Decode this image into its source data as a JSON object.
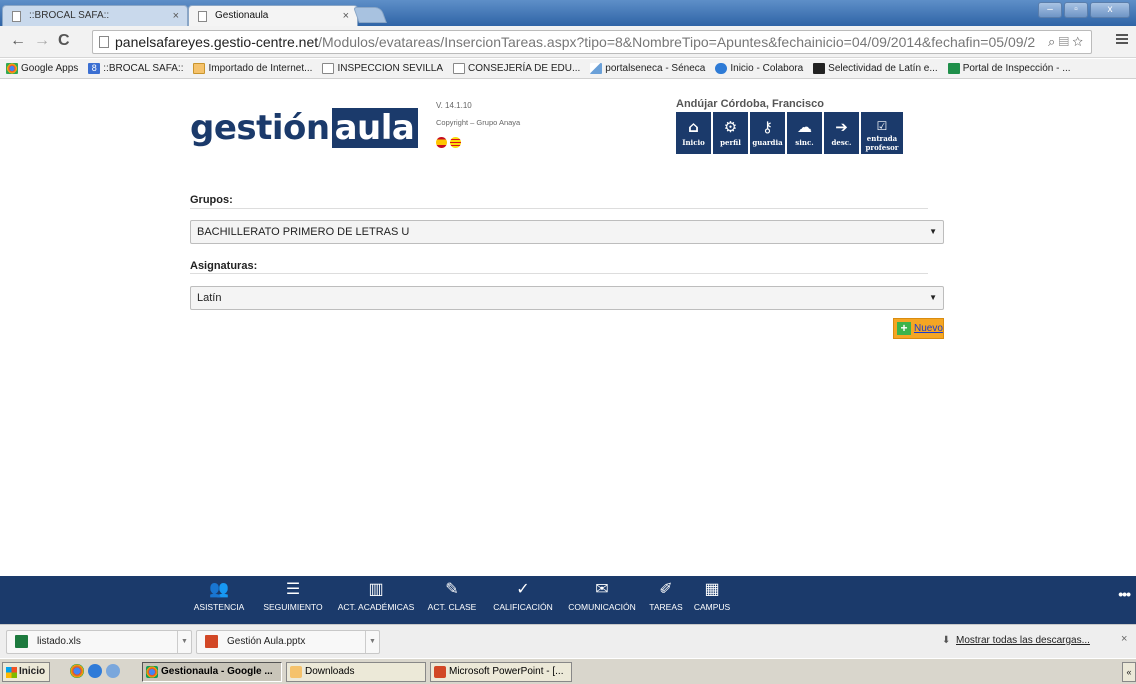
{
  "browser": {
    "tabs": [
      {
        "label": "::BROCAL SAFA::",
        "close": "×"
      },
      {
        "label": "Gestionaula",
        "close": "×"
      }
    ],
    "window_buttons": [
      "–",
      "▫",
      "x"
    ],
    "url_host": "panelsafareyes.gestio-centre.net",
    "url_path": "/Modulos/evatareas/InsercionTareas.aspx?tipo=8&NombreTipo=Apuntes&fechainicio=04/09/2014&fechafin=05/09/2",
    "bookmarks": [
      {
        "label": "Google Apps",
        "icon": "apps-grid-icon"
      },
      {
        "label": "::BROCAL SAFA::",
        "icon": "bookmark-8-icon"
      },
      {
        "label": "Importado de Internet...",
        "icon": "folder-icon"
      },
      {
        "label": "INSPECCION SEVILLA",
        "icon": "page-icon"
      },
      {
        "label": "CONSEJERÍA DE EDU...",
        "icon": "page-icon"
      },
      {
        "label": "portalseneca - Séneca",
        "icon": "pencil-icon"
      },
      {
        "label": "Inicio - Colabora",
        "icon": "globe-icon"
      },
      {
        "label": "Selectividad de Latín e...",
        "icon": "latin-icon"
      },
      {
        "label": "Portal de Inspección - ...",
        "icon": "green-icon"
      }
    ]
  },
  "header": {
    "logo_part1": "gestión",
    "logo_part2": "aula",
    "version": "V. 14.1.10",
    "copyright": "Copyright – Grupo Anaya",
    "user_name": "Andújar Córdoba, Francisco",
    "quick_buttons": [
      {
        "label": "Inicio",
        "glyph": "⌂"
      },
      {
        "label": "perfil",
        "glyph": "⚙"
      },
      {
        "label": "guardia",
        "glyph": "⚷"
      },
      {
        "label": "sinc.",
        "glyph": "☁"
      },
      {
        "label": "desc.",
        "glyph": "➔"
      },
      {
        "label_line1": "entrada",
        "label_line2": "profesor",
        "glyph": "☑"
      }
    ]
  },
  "form": {
    "grupos_label": "Grupos:",
    "grupos_value": "BACHILLERATO PRIMERO DE LETRAS U",
    "asignaturas_label": "Asignaturas:",
    "asignaturas_value": "Latín",
    "caret": "▼",
    "nuevo_label": "Nuevo"
  },
  "appbar": {
    "items": [
      {
        "label": "ASISTENCIA",
        "glyph": "👥"
      },
      {
        "label": "SEGUIMIENTO",
        "glyph": "☰"
      },
      {
        "label": "ACT. ACADÉMICAS",
        "glyph": "▥"
      },
      {
        "label": "ACT. CLASE",
        "glyph": "✎"
      },
      {
        "label": "CALIFICACIÓN",
        "glyph": "✓"
      },
      {
        "label": "COMUNICACIÓN",
        "glyph": "✉"
      },
      {
        "label": "TAREAS",
        "glyph": "✐"
      },
      {
        "label": "CAMPUS",
        "glyph": "▦"
      }
    ],
    "more": "•••"
  },
  "downloads": {
    "items": [
      {
        "label": "listado.xls"
      },
      {
        "label": "Gestión Aula.pptx"
      }
    ],
    "show_all": "Mostrar todas las descargas...",
    "close": "×"
  },
  "taskbar": {
    "start": "Inicio",
    "items": [
      {
        "label": "Gestionaula - Google ..."
      },
      {
        "label": "Downloads"
      },
      {
        "label": "Microsoft PowerPoint - [..."
      }
    ],
    "tray": "«"
  }
}
